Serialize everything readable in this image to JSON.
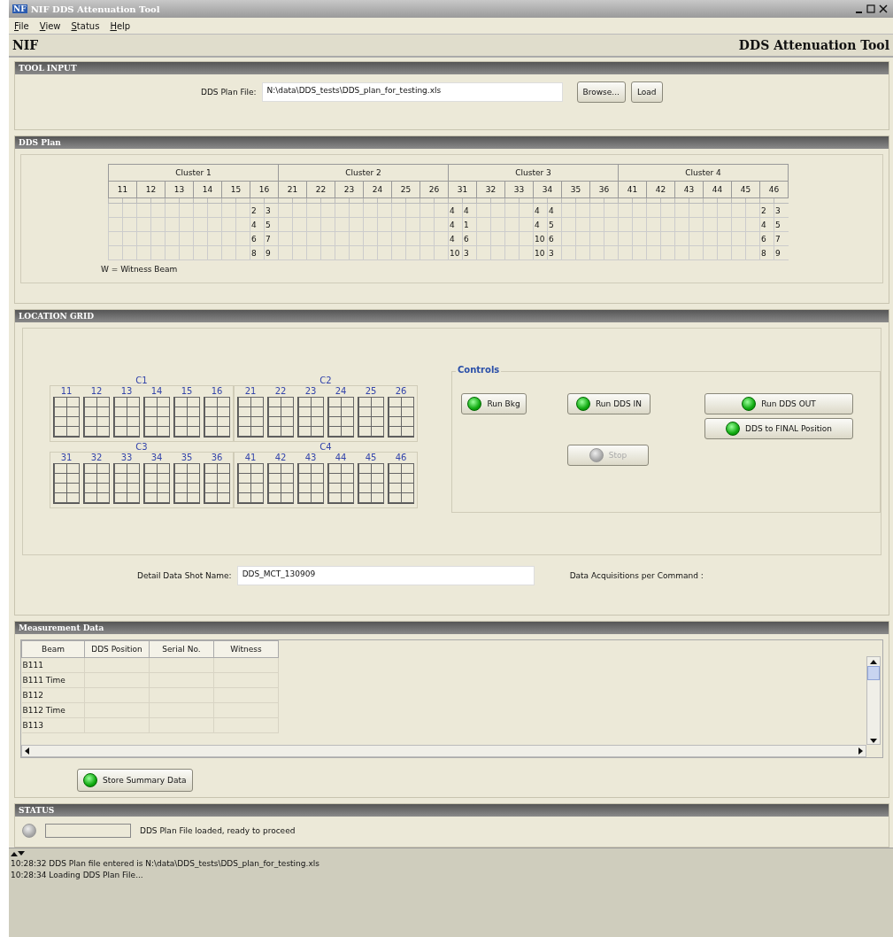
{
  "window": {
    "logo": "NF",
    "title": "NIF  DDS Attenuation Tool"
  },
  "menu": [
    "File",
    "View",
    "Status",
    "Help"
  ],
  "header": {
    "left": "NIF",
    "right": "DDS Attenuation Tool"
  },
  "tool_input": {
    "title": "TOOL INPUT",
    "label": "DDS Plan File:",
    "value": "N:\\data\\DDS_tests\\DDS_plan_for_testing.xls",
    "buttons": [
      "Browse...",
      "Load"
    ]
  },
  "dds_plan": {
    "title": "DDS Plan",
    "note": "W = Witness Beam",
    "clusters": [
      {
        "label": "Cluster 1",
        "beams": [
          {
            "label": "11"
          },
          {
            "label": "12"
          },
          {
            "label": "13"
          },
          {
            "label": "14"
          },
          {
            "label": "15"
          },
          {
            "label": "16",
            "rows": [
              [
                "2",
                "3"
              ],
              [
                "4",
                "5"
              ],
              [
                "6",
                "7"
              ],
              [
                "8",
                "9"
              ]
            ]
          }
        ]
      },
      {
        "label": "Cluster 2",
        "beams": [
          {
            "label": "21"
          },
          {
            "label": "22"
          },
          {
            "label": "23"
          },
          {
            "label": "24"
          },
          {
            "label": "25"
          },
          {
            "label": "26"
          }
        ]
      },
      {
        "label": "Cluster 3",
        "beams": [
          {
            "label": "31",
            "rows": [
              [
                "4",
                "4"
              ],
              [
                "4",
                "1"
              ],
              [
                "4",
                "6"
              ],
              [
                "10",
                "3"
              ]
            ]
          },
          {
            "label": "32"
          },
          {
            "label": "33"
          },
          {
            "label": "34",
            "rows": [
              [
                "4",
                "4"
              ],
              [
                "4",
                "5"
              ],
              [
                "10",
                "6"
              ],
              [
                "10",
                "3"
              ]
            ]
          },
          {
            "label": "35"
          },
          {
            "label": "36"
          }
        ]
      },
      {
        "label": "Cluster 4",
        "beams": [
          {
            "label": "41"
          },
          {
            "label": "42"
          },
          {
            "label": "43"
          },
          {
            "label": "44"
          },
          {
            "label": "45"
          },
          {
            "label": "46",
            "rows": [
              [
                "2",
                "3"
              ],
              [
                "4",
                "5"
              ],
              [
                "6",
                "7"
              ],
              [
                "8",
                "9"
              ]
            ]
          }
        ]
      }
    ]
  },
  "location_grid": {
    "title": "LOCATION GRID",
    "clusters": [
      {
        "label": "C1",
        "beams": [
          "11",
          "12",
          "13",
          "14",
          "15",
          "16"
        ]
      },
      {
        "label": "C2",
        "beams": [
          "21",
          "22",
          "23",
          "24",
          "25",
          "26"
        ]
      },
      {
        "label": "C3",
        "beams": [
          "31",
          "32",
          "33",
          "34",
          "35",
          "36"
        ]
      },
      {
        "label": "C4",
        "beams": [
          "41",
          "42",
          "43",
          "44",
          "45",
          "46"
        ]
      }
    ],
    "controls": {
      "title": "Controls",
      "buttons": [
        {
          "label": "Run Bkg",
          "disabled": false
        },
        {
          "label": "Run DDS IN",
          "disabled": false
        },
        {
          "label": "Run DDS OUT",
          "disabled": false
        },
        {
          "label": "DDS to FINAL Position",
          "disabled": false
        },
        {
          "label": "Stop",
          "disabled": true
        }
      ]
    },
    "shot_label": "Detail Data Shot Name:",
    "shot_value": "DDS_MCT_130909",
    "acq_label": "Data Acquisitions per Command :"
  },
  "measurement": {
    "title": "Measurement Data",
    "columns": [
      "Beam",
      "DDS Position",
      "Serial No.",
      "Witness"
    ],
    "rows": [
      "B111",
      "B111 Time",
      "B112",
      "B112 Time",
      "B113"
    ],
    "store_button": "Store Summary Data"
  },
  "status": {
    "title": "STATUS",
    "led_on": false,
    "message": "DDS Plan File loaded, ready to proceed"
  },
  "log": [
    "10:28:32  DDS Plan file entered is N:\\data\\DDS_tests\\DDS_plan_for_testing.xls",
    "10:28:34  Loading DDS Plan File..."
  ]
}
